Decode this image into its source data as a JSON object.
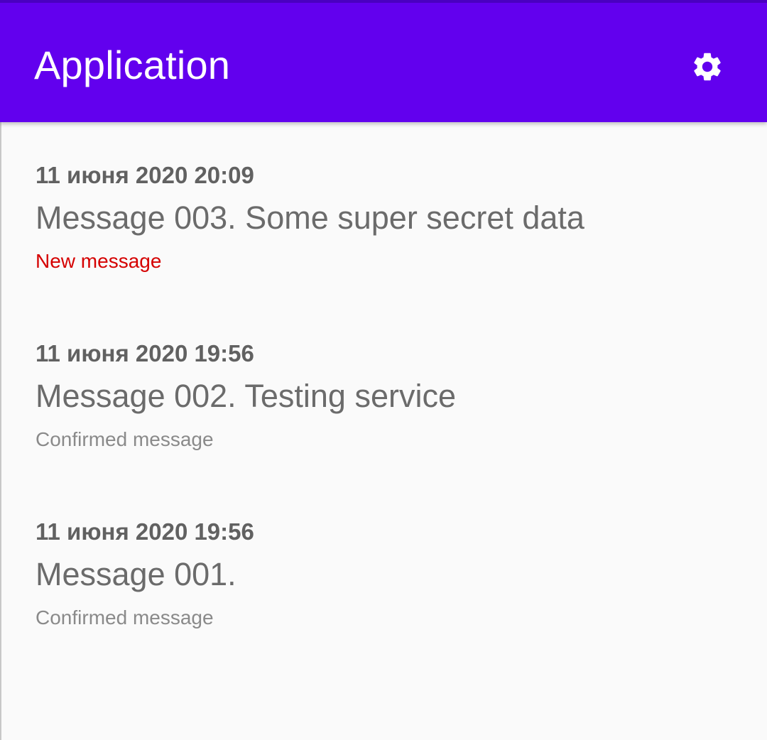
{
  "app_bar": {
    "title": "Application",
    "settings_icon": "gear-icon",
    "background_color": "#6200ee"
  },
  "messages": [
    {
      "date": "11 июня 2020 20:09",
      "text": "Message 003. Some super secret data",
      "status": "New message",
      "status_color": "#d50000"
    },
    {
      "date": "11 июня 2020 19:56",
      "text": "Message 002. Testing service",
      "status": "Confirmed message",
      "status_color": "#8a8a8a"
    },
    {
      "date": "11 июня 2020 19:56",
      "text": "Message 001.",
      "status": "Confirmed message",
      "status_color": "#8a8a8a"
    }
  ]
}
